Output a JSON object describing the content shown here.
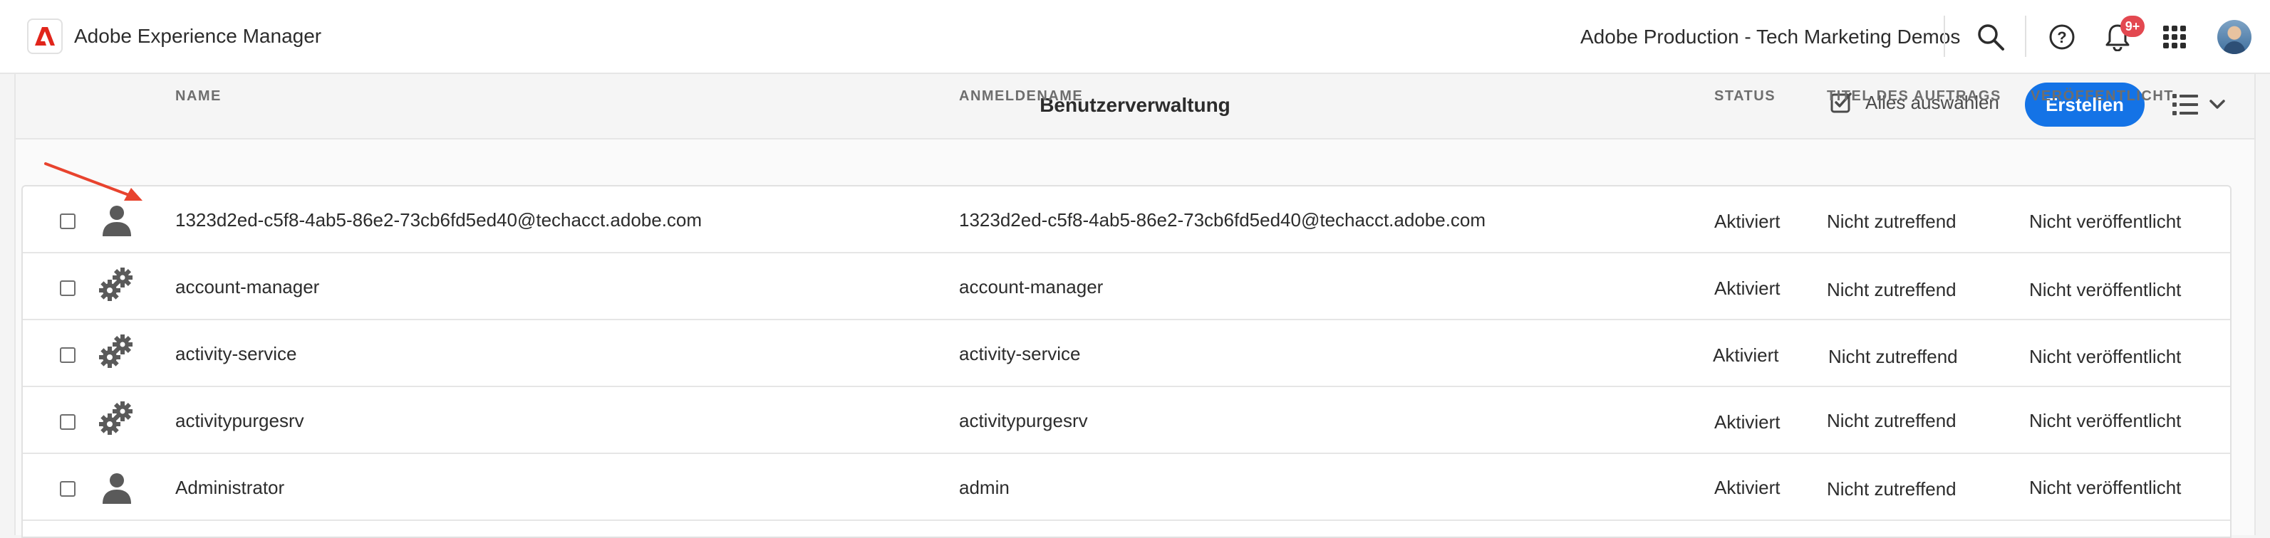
{
  "shell": {
    "app_name": "Adobe Experience Manager",
    "org_name": "Adobe Production - Tech Marketing Demos",
    "notification_badge": "9+",
    "brand_color": "#e1251b"
  },
  "toolbar": {
    "title": "Benutzerverwaltung",
    "select_all_label": "Alles auswählen",
    "create_label": "Erstellen",
    "accent_color": "#1473e6"
  },
  "table": {
    "headers": {
      "name": "NAME",
      "login": "ANMELDENAME",
      "status": "STATUS",
      "job_title": "TITEL DES AUFTRAGS",
      "published": "VERÖFFENTLICHT"
    },
    "rows": [
      {
        "icon": "user-icon",
        "name": "1323d2ed-c5f8-4ab5-86e2-73cb6fd5ed40@techacct.adobe.com",
        "login": "1323d2ed-c5f8-4ab5-86e2-73cb6fd5ed40@techacct.adobe.com",
        "status": "Aktiviert",
        "job_title": "Nicht zutreffend",
        "published": "Nicht veröffentlicht"
      },
      {
        "icon": "service-user-icon",
        "name": "account-manager",
        "login": "account-manager",
        "status": "Aktiviert",
        "job_title": "Nicht zutreffend",
        "published": "Nicht veröffentlicht"
      },
      {
        "icon": "service-user-icon",
        "name": "activity-service",
        "login": "activity-service",
        "status": "Aktiviert",
        "job_title": "Nicht zutreffend",
        "published": "Nicht veröffentlicht"
      },
      {
        "icon": "service-user-icon",
        "name": "activitypurgesrv",
        "login": "activitypurgesrv",
        "status": "Aktiviert",
        "job_title": "Nicht zutreffend",
        "published": "Nicht veröffentlicht"
      },
      {
        "icon": "user-icon",
        "name": "Administrator",
        "login": "admin",
        "status": "Aktiviert",
        "job_title": "Nicht zutreffend",
        "published": "Nicht veröffentlicht"
      }
    ]
  },
  "annotation": {
    "arrow_color": "#e8432e"
  }
}
